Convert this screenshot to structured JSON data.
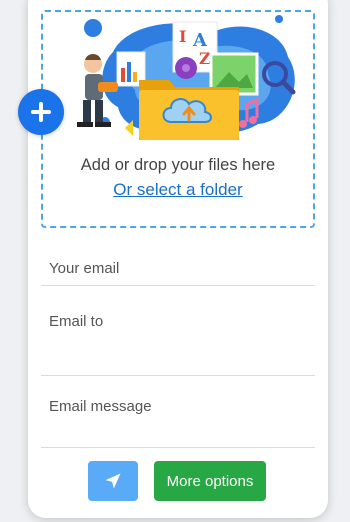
{
  "upload": {
    "drop_text": "Add or drop your files here",
    "folder_link": "Or select a folder",
    "add_icon": "plus-icon"
  },
  "form": {
    "email_placeholder": "Your email",
    "email_to_placeholder": "Email to",
    "message_placeholder": "Email message"
  },
  "actions": {
    "send_icon": "paper-plane-icon",
    "more_options_label": "More options"
  },
  "colors": {
    "accent_blue": "#1a73e8",
    "send_blue": "#5aabf7",
    "success_green": "#28a745",
    "dashed_border": "#4aa8e0"
  }
}
